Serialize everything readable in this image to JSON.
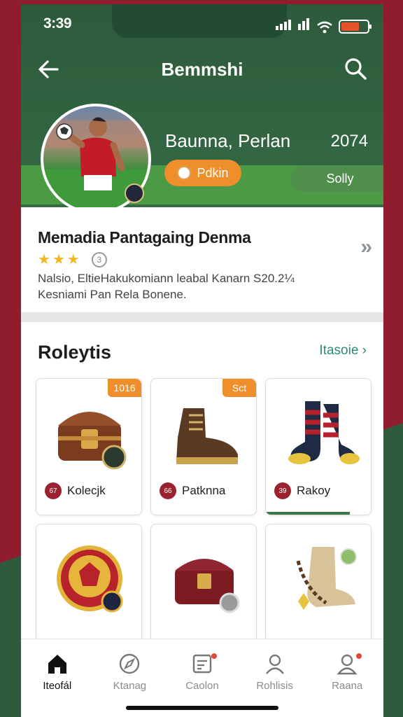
{
  "status_bar": {
    "time": "3:39"
  },
  "header": {
    "title": "Bemmshi"
  },
  "profile": {
    "name": "Baunna, Perlan",
    "year": "2074",
    "primary_pill": "Pdkin",
    "secondary_pill": "Solly"
  },
  "info_card": {
    "title": "Memadia Pantagaing Denma",
    "rating_icon": "3",
    "description_line1": "Nalsio, EltieHakukomiann leabal Kanarn S20.2¼",
    "description_line2": "Kesniami Pan Rela Bonene."
  },
  "section": {
    "title": "Roleytis",
    "link": "Itasoie"
  },
  "items": [
    {
      "name": "Kolecjk",
      "tag": "1016",
      "icon": "treasure-chest-icon",
      "badge": "67"
    },
    {
      "name": "Patknna",
      "tag": "Sct",
      "icon": "boot-icon",
      "badge": "66"
    },
    {
      "name": "Rakoy",
      "tag": "",
      "icon": "socks-icon",
      "badge": "39",
      "progress": 0.8
    },
    {
      "name": "",
      "tag": "",
      "icon": "medal-icon"
    },
    {
      "name": "",
      "tag": "",
      "icon": "chest-icon"
    },
    {
      "name": "",
      "tag": "",
      "icon": "bead-boot-icon"
    }
  ],
  "bottom_nav": [
    {
      "label": "Iteofál",
      "icon": "home-icon",
      "active": true
    },
    {
      "label": "Ktanag",
      "icon": "compass-icon",
      "active": false
    },
    {
      "label": "Caolon",
      "icon": "news-icon",
      "active": false
    },
    {
      "label": "Rohlisis",
      "icon": "person-icon",
      "active": false
    },
    {
      "label": "Raana",
      "icon": "profile-icon",
      "active": false
    }
  ],
  "colors": {
    "header_green": "#2d5a3b",
    "accent_orange": "#ef8f2b",
    "accent_teal": "#2c8a73",
    "brand_red": "#9b2330"
  }
}
